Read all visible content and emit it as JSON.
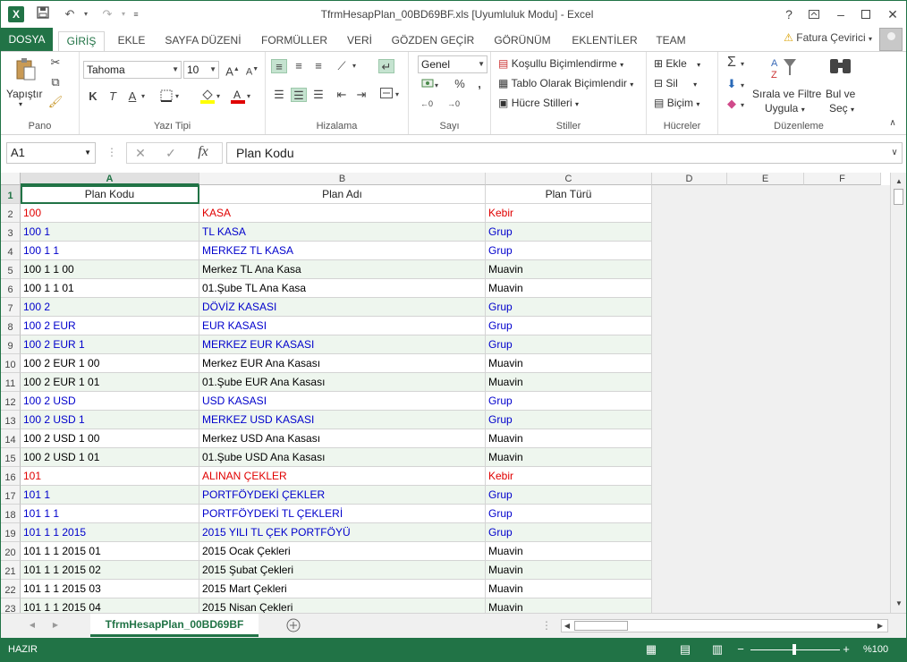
{
  "window": {
    "title": "TfrmHesapPlan_00BD69BF.xls  [Uyumluluk Modu] - Excel",
    "help": "?",
    "app_icon": "X"
  },
  "tabs": {
    "file": "DOSYA",
    "items": [
      "GİRİŞ",
      "EKLE",
      "SAYFA DÜZENİ",
      "FORMÜLLER",
      "VERİ",
      "GÖZDEN GEÇİR",
      "GÖRÜNÜM",
      "EKLENTİLER",
      "TEAM"
    ],
    "active": "GİRİŞ",
    "user": "Fatura Çevirici"
  },
  "ribbon": {
    "pano": {
      "label": "Pano",
      "paste": "Yapıştır"
    },
    "font": {
      "label": "Yazı Tipi",
      "name": "Tahoma",
      "size": "10",
      "bold": "K",
      "italic": "T",
      "underline": "A"
    },
    "align": {
      "label": "Hizalama"
    },
    "number": {
      "label": "Sayı",
      "format": "Genel"
    },
    "styles": {
      "label": "Stiller",
      "cond": "Koşullu Biçimlendirme",
      "table": "Tablo Olarak Biçimlendir",
      "cell": "Hücre Stilleri"
    },
    "cells": {
      "label": "Hücreler",
      "insert": "Ekle",
      "delete": "Sil",
      "format": "Biçim"
    },
    "edit": {
      "label": "Düzenleme",
      "sort_line1": "Sırala ve Filtre",
      "sort_line2": "Uygula",
      "find_line1": "Bul ve",
      "find_line2": "Seç"
    }
  },
  "formula_bar": {
    "name_box": "A1",
    "fx": "fx",
    "content": "Plan Kodu"
  },
  "colors": {
    "accent": "#217346",
    "red": "#e00000",
    "blue": "#0000cc",
    "black": "#000000"
  },
  "grid": {
    "columns": [
      "A",
      "B",
      "C",
      "D",
      "E",
      "F"
    ],
    "header": [
      "Plan Kodu",
      "Plan Adı",
      "Plan Türü"
    ],
    "rows": [
      {
        "n": "1"
      },
      {
        "n": "2",
        "a": "100",
        "b": "KASA",
        "c": "Kebir",
        "color": "red"
      },
      {
        "n": "3",
        "a": "100 1",
        "b": "TL KASA",
        "c": "Grup",
        "color": "blue"
      },
      {
        "n": "4",
        "a": "100 1 1",
        "b": "MERKEZ  TL  KASA",
        "c": "Grup",
        "color": "blue"
      },
      {
        "n": "5",
        "a": "100 1 1 00",
        "b": "Merkez  TL  Ana Kasa",
        "c": "Muavin",
        "color": "black"
      },
      {
        "n": "6",
        "a": "100 1 1 01",
        "b": "01.Şube TL  Ana Kasa",
        "c": "Muavin",
        "color": "black"
      },
      {
        "n": "7",
        "a": "100 2",
        "b": "DÖVİZ KASASI",
        "c": "Grup",
        "color": "blue"
      },
      {
        "n": "8",
        "a": "100 2 EUR",
        "b": "EUR KASASI",
        "c": "Grup",
        "color": "blue"
      },
      {
        "n": "9",
        "a": "100 2 EUR 1",
        "b": "MERKEZ  EUR KASASI",
        "c": "Grup",
        "color": "blue"
      },
      {
        "n": "10",
        "a": "100 2 EUR 1 00",
        "b": "Merkez  EUR Ana Kasası",
        "c": "Muavin",
        "color": "black"
      },
      {
        "n": "11",
        "a": "100 2 EUR 1 01",
        "b": "01.Şube EUR Ana Kasası",
        "c": "Muavin",
        "color": "black"
      },
      {
        "n": "12",
        "a": "100 2 USD",
        "b": "USD  KASASI",
        "c": "Grup",
        "color": "blue"
      },
      {
        "n": "13",
        "a": "100 2 USD 1",
        "b": "MERKEZ  USD KASASI",
        "c": "Grup",
        "color": "blue"
      },
      {
        "n": "14",
        "a": "100 2 USD 1 00",
        "b": "Merkez  USD Ana Kasası",
        "c": "Muavin",
        "color": "black"
      },
      {
        "n": "15",
        "a": "100 2 USD 1 01",
        "b": "01.Şube USD Ana Kasası",
        "c": "Muavin",
        "color": "black"
      },
      {
        "n": "16",
        "a": "101",
        "b": "ALINAN ÇEKLER",
        "c": "Kebir",
        "color": "red"
      },
      {
        "n": "17",
        "a": "101 1",
        "b": "PORTFÖYDEKİ ÇEKLER",
        "c": "Grup",
        "color": "blue"
      },
      {
        "n": "18",
        "a": "101 1 1",
        "b": "PORTFÖYDEKİ  TL  ÇEKLERİ",
        "c": "Grup",
        "color": "blue"
      },
      {
        "n": "19",
        "a": "101 1 1 2015",
        "b": "2015 YILI TL ÇEK PORTFÖYÜ",
        "c": "Grup",
        "color": "blue"
      },
      {
        "n": "20",
        "a": "101 1 1 2015 01",
        "b": "2015 Ocak     Çekleri",
        "c": "Muavin",
        "color": "black"
      },
      {
        "n": "21",
        "a": "101 1 1 2015 02",
        "b": "2015 Şubat    Çekleri",
        "c": "Muavin",
        "color": "black"
      },
      {
        "n": "22",
        "a": "101 1 1 2015 03",
        "b": "2015 Mart     Çekleri",
        "c": "Muavin",
        "color": "black"
      },
      {
        "n": "23",
        "a": "101 1 1 2015 04",
        "b": "2015 Nisan    Çekleri",
        "c": "Muavin",
        "color": "black"
      }
    ]
  },
  "sheet": {
    "tab": "TfrmHesapPlan_00BD69BF"
  },
  "status": {
    "ready": "HAZIR",
    "zoom": "%100"
  }
}
